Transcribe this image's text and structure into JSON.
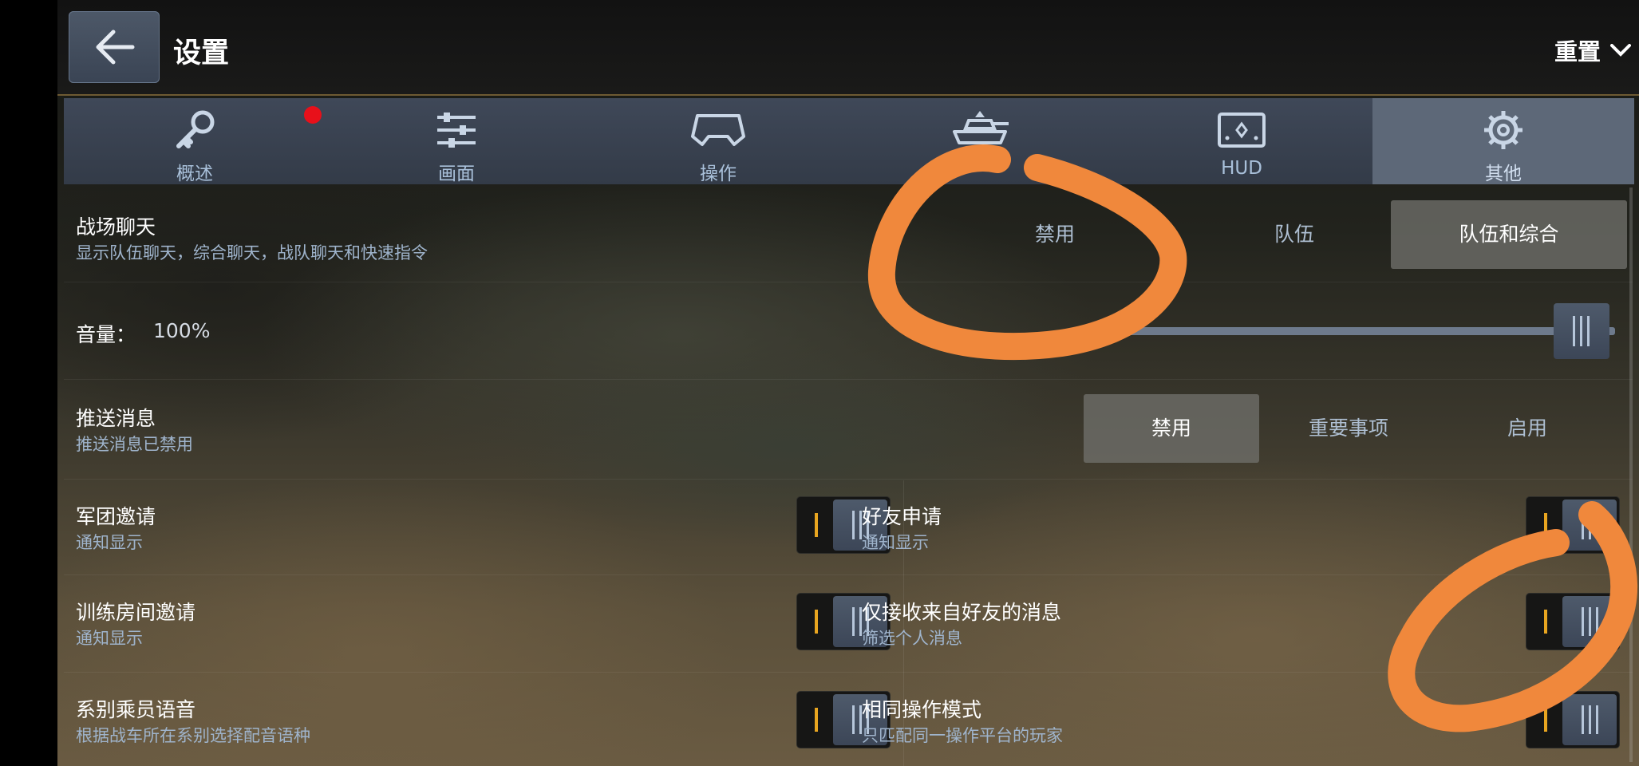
{
  "header": {
    "title": "设置",
    "reset_label": "重置"
  },
  "tabs": [
    {
      "label": "概述",
      "icon": "key-icon",
      "badge": true
    },
    {
      "label": "画面",
      "icon": "sliders-icon"
    },
    {
      "label": "操作",
      "icon": "gamepad-icon"
    },
    {
      "label": "",
      "icon": "tank-icon"
    },
    {
      "label": "HUD",
      "icon": "hud-icon"
    },
    {
      "label": "其他",
      "icon": "gear-icon",
      "active": true
    }
  ],
  "battle_chat": {
    "label": "战场聊天",
    "desc": "显示队伍聊天，综合聊天，战队聊天和快速指令",
    "options": [
      "禁用",
      "队伍",
      "队伍和综合"
    ],
    "selected": "队伍和综合"
  },
  "volume": {
    "label": "音量：",
    "value": "100%",
    "level": 1.0
  },
  "push": {
    "label": "推送消息",
    "desc": "推送消息已禁用",
    "options": [
      "禁用",
      "重要事项",
      "启用"
    ],
    "selected": "禁用"
  },
  "toggles": {
    "clan_invite": {
      "label": "军团邀请",
      "desc": "通知显示",
      "on": true
    },
    "friend_request": {
      "label": "好友申请",
      "desc": "通知显示",
      "on": true
    },
    "training_invite": {
      "label": "训练房间邀请",
      "desc": "通知显示",
      "on": true
    },
    "friends_only": {
      "label": "仅接收来自好友的消息",
      "desc": "筛选个人消息",
      "on": true
    },
    "crew_voice": {
      "label": "系别乘员语音",
      "desc": "根据战车所在系别选择配音语种",
      "on": true
    },
    "same_control": {
      "label": "相同操作模式",
      "desc": "只匹配同一操作平台的玩家",
      "on": true
    }
  },
  "colors": {
    "accent": "#e8a520",
    "annotation": "#f0883c",
    "badge": "#e8101a"
  }
}
